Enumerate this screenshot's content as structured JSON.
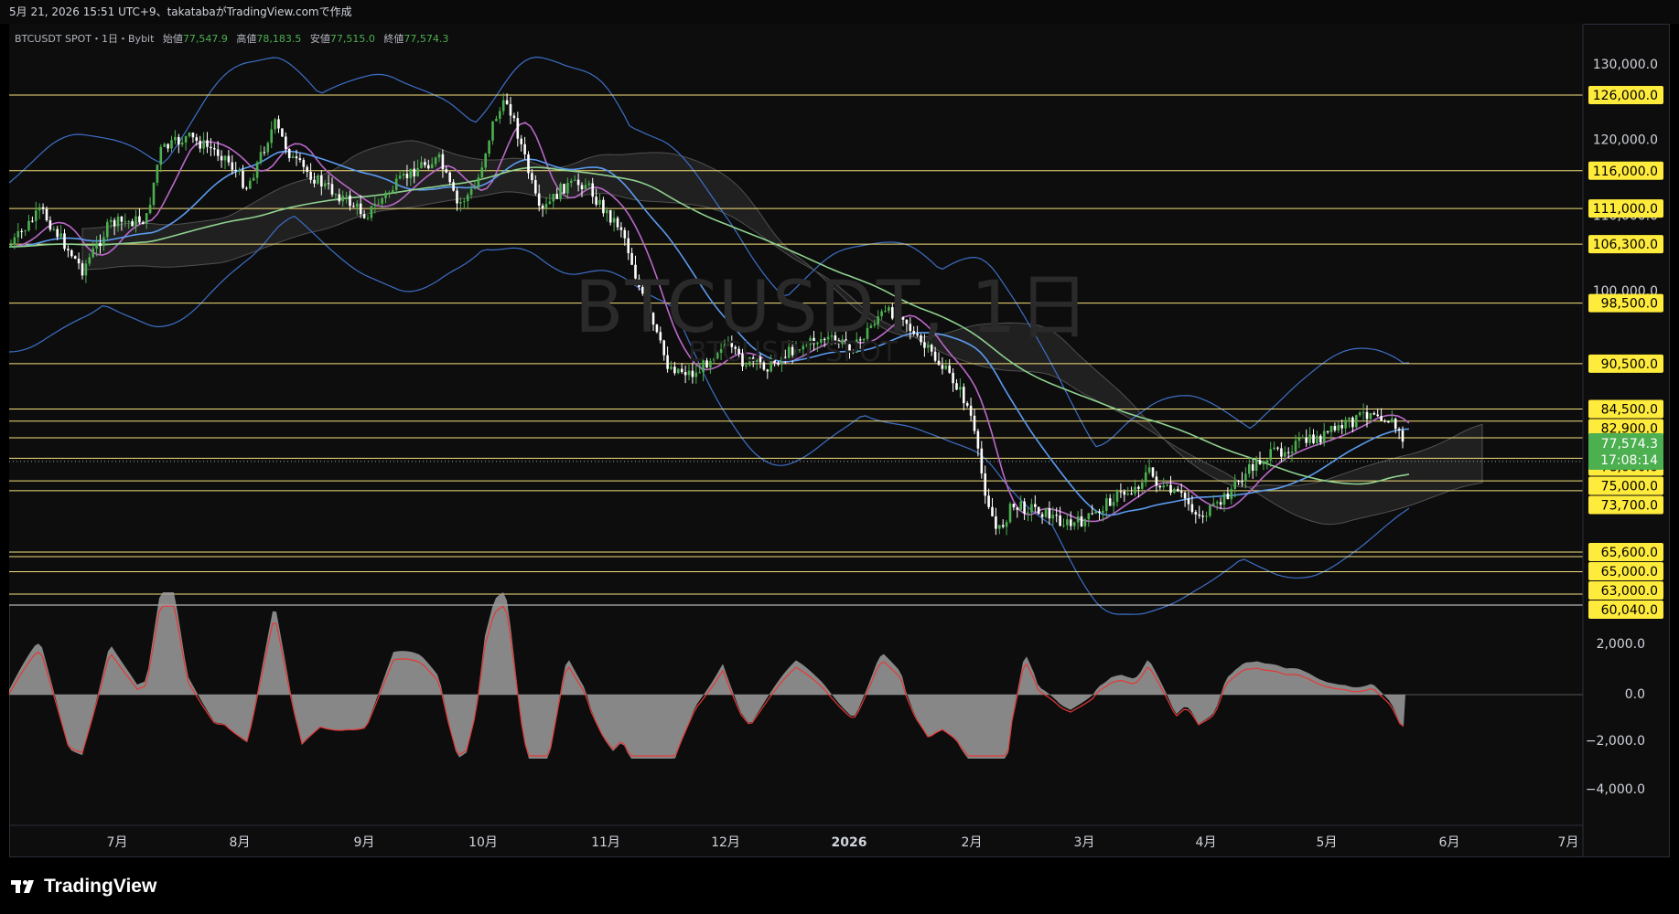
{
  "header": {
    "info": "5月 21, 2026 15:51 UTC+9、takatabaがTradingView.comで作成"
  },
  "legend": {
    "symbol": "BTCUSDT SPOT・1日・Bybit",
    "open_label": "始値",
    "open": "77,547.9",
    "high_label": "高値",
    "high": "78,183.5",
    "low_label": "安値",
    "low": "77,515.0",
    "close_label": "終値",
    "close": "77,574.3"
  },
  "watermark": {
    "main": "BTCUSDT, 1日",
    "sub": "BTCUSDT SPOT"
  },
  "price_axis": {
    "ticks": [
      "130,000.0",
      "120,000.0",
      "110,000.0",
      "100,000.0"
    ],
    "levels": [
      {
        "label": "126,000.0",
        "price": 126000
      },
      {
        "label": "116,000.0",
        "price": 116000
      },
      {
        "label": "111,000.0",
        "price": 111000
      },
      {
        "label": "106,300.0",
        "price": 106300
      },
      {
        "label": "98,500.0",
        "price": 98500
      },
      {
        "label": "90,500.0",
        "price": 90500
      },
      {
        "label": "84,500.0",
        "price": 84500
      },
      {
        "label": "82,900.0",
        "price": 82900
      },
      {
        "label": "80,700.0",
        "price": 80700
      },
      {
        "label": "78,000.0",
        "price": 78000
      },
      {
        "label": "75,000.0",
        "price": 75000
      },
      {
        "label": "73,700.0",
        "price": 73700
      },
      {
        "label": "65,600.0",
        "price": 65600
      },
      {
        "label": "65,000.0",
        "price": 65000
      },
      {
        "label": "63,000.0",
        "price": 63000
      },
      {
        "label": "60,040.0",
        "price": 60040
      }
    ],
    "current_price": "77,574.3",
    "countdown": "17:08:14"
  },
  "macd_axis": {
    "ticks": [
      "2,000.0",
      "0.0",
      "−2,000.0",
      "−4,000.0"
    ]
  },
  "time_axis": {
    "labels": [
      "7月",
      "8月",
      "9月",
      "10月",
      "11月",
      "12月",
      "2026",
      "2月",
      "3月",
      "4月",
      "5月",
      "6月",
      "7月"
    ]
  },
  "brand": {
    "name": "TradingView"
  },
  "colors": {
    "up": "#4caf50",
    "down": "#ffffff",
    "level_line": "#f5e07a",
    "level_badge": "#ffeb3b",
    "price_badge": "#4caf50",
    "ma_fast": "#ba68c8",
    "ma_mid": "#5b9bf0",
    "ma_slow": "#8fd18f",
    "bands": "#3d6fc7",
    "cloud": "#8a8a8a",
    "macd_hist": "#9e9e9e",
    "macd_signal": "#e53935"
  }
}
